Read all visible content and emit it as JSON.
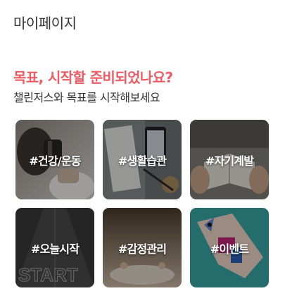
{
  "header": {
    "title": "마이페이지"
  },
  "intro": {
    "headline": "목표, 시작할 준비되었나요?",
    "subheadline": "챌린저스와 목표를 시작해보세요"
  },
  "categories": [
    {
      "label": "#건강/운동"
    },
    {
      "label": "#생활습관"
    },
    {
      "label": "#자기계발"
    },
    {
      "label": "#오늘시작"
    },
    {
      "label": "#감정관리"
    },
    {
      "label": "#이벤트"
    }
  ],
  "colors": {
    "accent": "#ef5a64",
    "text": "#333333",
    "background": "#ffffff"
  }
}
